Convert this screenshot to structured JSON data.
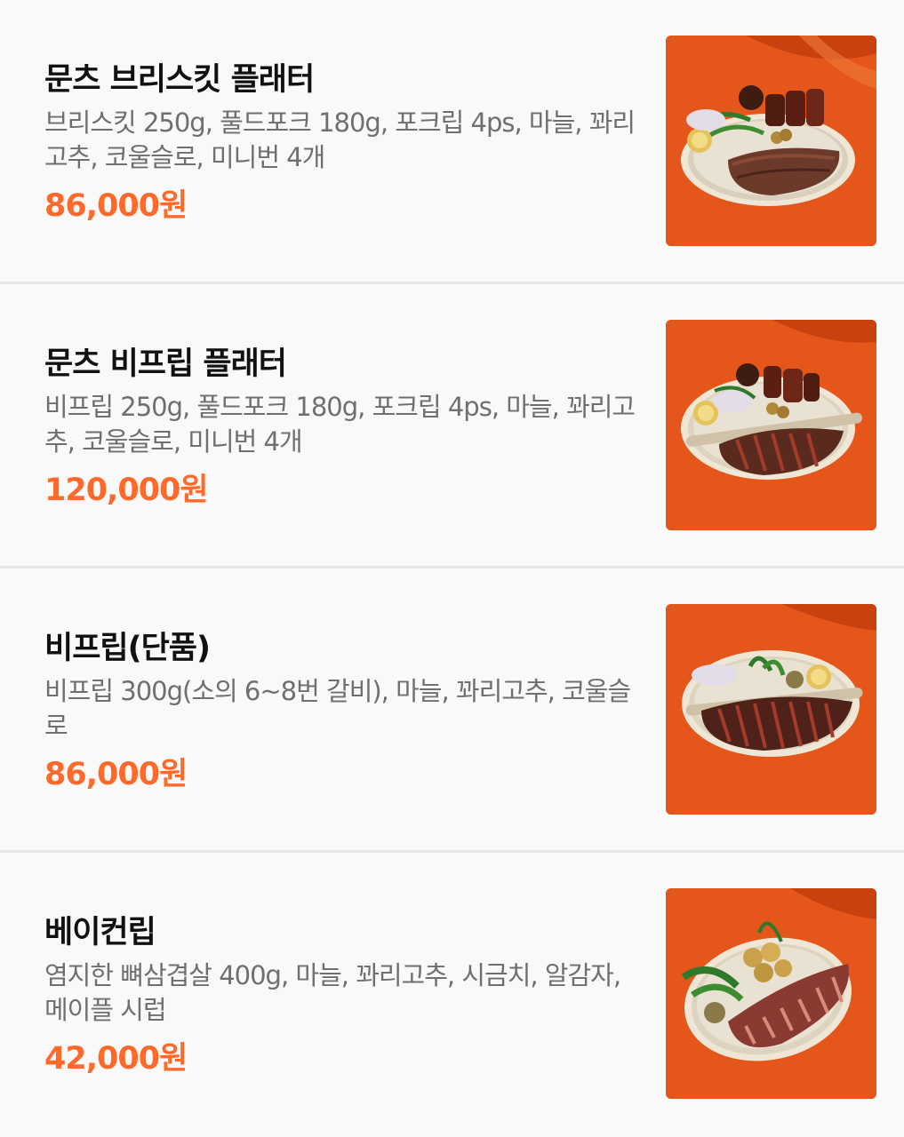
{
  "menu": {
    "items": [
      {
        "name": "문츠 브리스킷 플래터",
        "description": "브리스킷 250g, 풀드포크 180g, 포크립 4ps, 마늘, 꽈리고추, 코울슬로, 미니번 4개",
        "price": "86,000원",
        "photo": "brisket-platter-photo"
      },
      {
        "name": "문츠 비프립 플래터",
        "description": "비프립 250g, 풀드포크 180g, 포크립 4ps, 마늘, 꽈리고추, 코울슬로, 미니번 4개",
        "price": "120,000원",
        "photo": "beef-rib-platter-photo"
      },
      {
        "name": "비프립(단품)",
        "description": "비프립 300g(소의 6~8번 갈비), 마늘, 꽈리고추, 코울슬로",
        "price": "86,000원",
        "photo": "beef-rib-single-photo"
      },
      {
        "name": "베이컨립",
        "description": "염지한 뼈삼겹살 400g, 마늘, 꽈리고추, 시금치, 알감자, 메이플 시럽",
        "price": "42,000원",
        "photo": "bacon-rib-photo"
      }
    ]
  },
  "colors": {
    "price": "#ff6a2b",
    "name": "#111111",
    "description": "#6f6f6f",
    "photo_background": "#e85a1c"
  }
}
